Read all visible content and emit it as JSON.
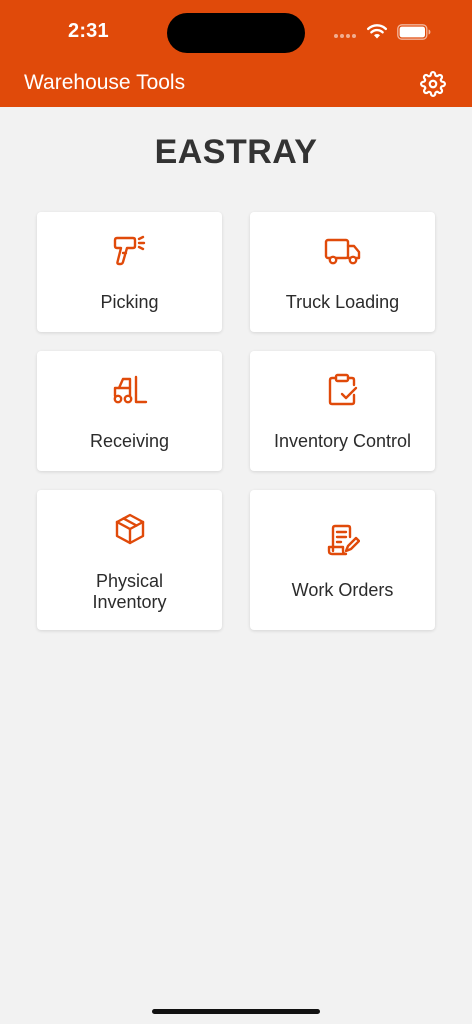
{
  "status_bar": {
    "time": "2:31"
  },
  "app_bar": {
    "title": "Warehouse Tools",
    "settings_icon": "gear-icon"
  },
  "brand": {
    "name": "EASTRAY"
  },
  "colors": {
    "accent": "#e04a0a",
    "background": "#f2f2f2",
    "tile": "#ffffff",
    "text": "#2b2b2b"
  },
  "tiles": [
    {
      "label": "Picking",
      "icon": "barcode-scanner-icon"
    },
    {
      "label": "Truck Loading",
      "icon": "truck-icon"
    },
    {
      "label": "Receiving",
      "icon": "forklift-icon"
    },
    {
      "label": "Inventory Control",
      "icon": "clipboard-check-icon"
    },
    {
      "label_lines": [
        "Physical",
        "Inventory"
      ],
      "icon": "box-icon"
    },
    {
      "label": "Work Orders",
      "icon": "document-edit-icon"
    }
  ]
}
